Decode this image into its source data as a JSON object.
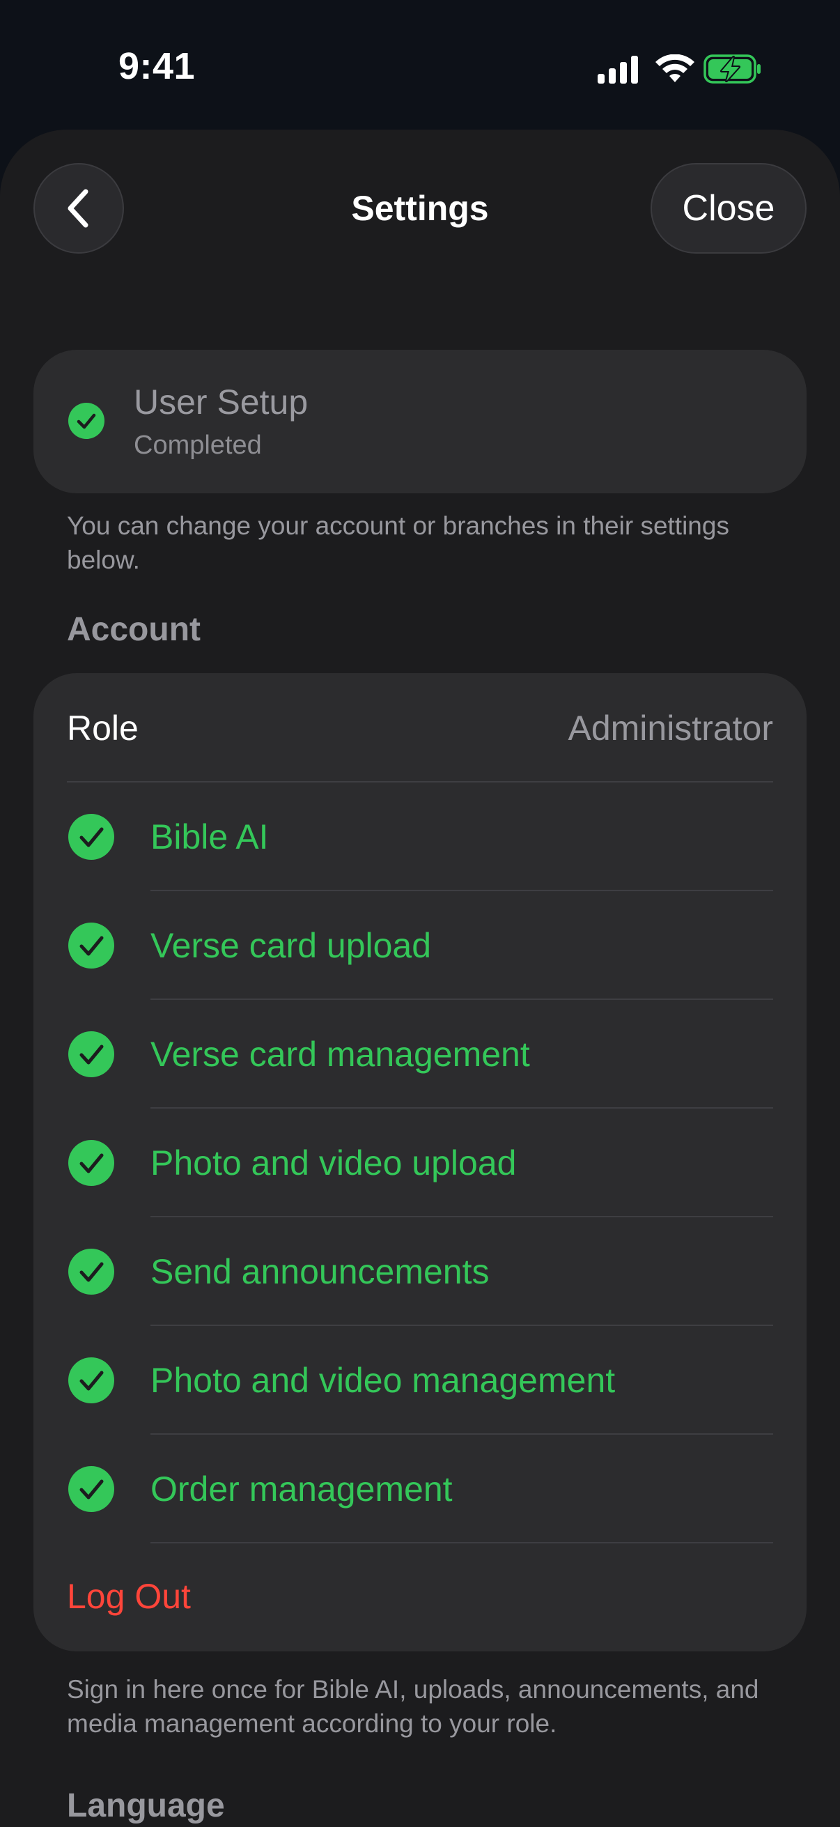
{
  "status_bar": {
    "time": "9:41"
  },
  "nav": {
    "title": "Settings",
    "close_label": "Close"
  },
  "setup": {
    "title": "User Setup",
    "status": "Completed",
    "footnote": "You can change your account or branches in their settings below."
  },
  "account": {
    "header": "Account",
    "role_label": "Role",
    "role_value": "Administrator",
    "permissions": [
      {
        "label": "Bible AI"
      },
      {
        "label": "Verse card upload"
      },
      {
        "label": "Verse card management"
      },
      {
        "label": "Photo and video upload"
      },
      {
        "label": "Send announcements"
      },
      {
        "label": "Photo and video management"
      },
      {
        "label": "Order management"
      }
    ],
    "logout_label": "Log Out",
    "footnote": "Sign in here once for Bible AI, uploads, announcements, and media management according to your role."
  },
  "language": {
    "header": "Language"
  },
  "colors": {
    "accent_green": "#34c759",
    "destructive_red": "#ff453a"
  }
}
